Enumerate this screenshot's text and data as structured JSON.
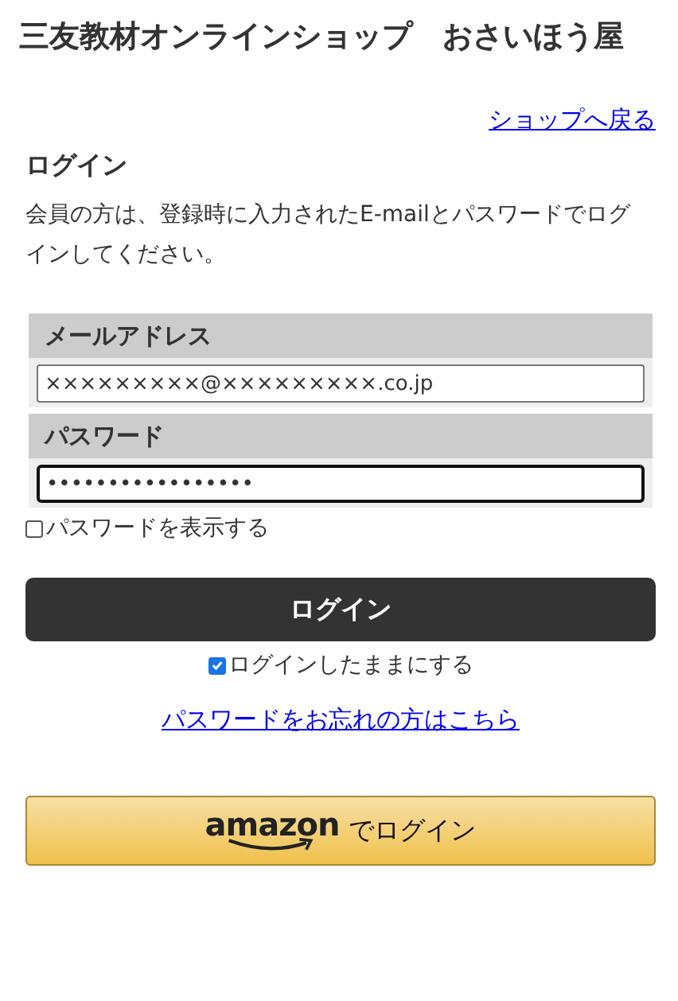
{
  "header": {
    "title": "三友教材オンラインショップ　おさいほう屋"
  },
  "back_link": "ショップへ戻る",
  "login": {
    "heading": "ログイン",
    "description": "会員の方は、登録時に入力されたE-mailとパスワードでログインしてください。",
    "fields": [
      {
        "label": "メールアドレス",
        "value": "×××××××××@×××××××××.co.jp",
        "focused": false
      },
      {
        "label": "パスワード",
        "value": "•••••••••••••••••",
        "focused": true
      }
    ],
    "show_password": {
      "label": "パスワードを表示する",
      "checked": false
    },
    "submit": "ログイン",
    "remember": {
      "label": "ログインしたままにする",
      "checked": true
    },
    "forgot_link": "パスワードをお忘れの方はこちら",
    "amazon": {
      "logo": "amazon",
      "label": "でログイン"
    }
  }
}
